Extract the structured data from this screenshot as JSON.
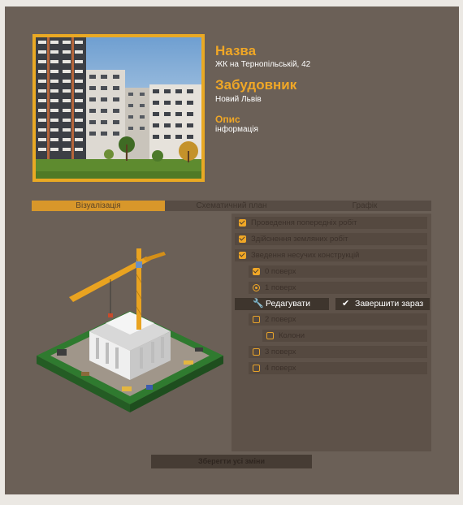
{
  "header": {
    "name_heading": "Назва",
    "name_value": "ЖК на Тернопільській, 42",
    "developer_heading": "Забудовник",
    "developer_value": "Новий Львів",
    "description_heading": "Опис",
    "description_value": "інформація"
  },
  "tabs": [
    {
      "label": "Візуалізація",
      "active": true
    },
    {
      "label": "Схематичний план",
      "active": false
    },
    {
      "label": "Графік",
      "active": false
    }
  ],
  "stages": [
    {
      "label": "Проведення попередніх робіт",
      "state": "checked",
      "level": 0
    },
    {
      "label": "Здійснення земляних робіт",
      "state": "checked",
      "level": 0
    },
    {
      "label": "Зведення несучих конструкцій",
      "state": "checked",
      "level": 0
    },
    {
      "label": "0 поверх",
      "state": "checked",
      "level": 1
    },
    {
      "label": "1 поверх",
      "state": "current",
      "level": 1
    },
    {
      "label": "2 поверх",
      "state": "unchecked",
      "level": 1
    },
    {
      "label": "Колони",
      "state": "unchecked",
      "level": 2
    },
    {
      "label": "3 поверх",
      "state": "unchecked",
      "level": 1
    },
    {
      "label": "4 поверх",
      "state": "unchecked",
      "level": 1
    }
  ],
  "actions": {
    "edit_label": "Редагувати",
    "edit_icon": "wrench-icon",
    "finish_label": "Завершити зараз",
    "finish_icon": "checkmark-icon"
  },
  "save_label": "Зберегти усі зміни",
  "colors": {
    "background": "#6b6057",
    "accent": "#f0a726",
    "panel": "#5e5249"
  }
}
